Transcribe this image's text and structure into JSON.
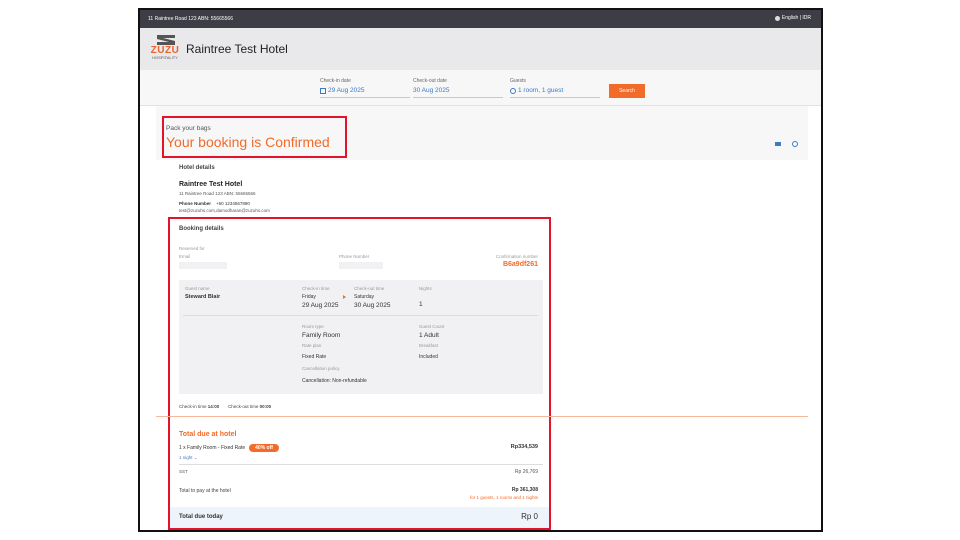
{
  "topbar": {
    "address": "11 Raintree Road 123 ABN: 55665566",
    "language": "English | IDR"
  },
  "logo": {
    "text": "ZUZU",
    "sub": "HOSPITALITY"
  },
  "hotel": {
    "name": "Raintree Test Hotel"
  },
  "search": {
    "checkin_label": "Check-in date",
    "checkin_value": "29 Aug 2025",
    "checkout_label": "Check-out date",
    "checkout_value": "30 Aug 2025",
    "guests_label": "Guests",
    "guests_value": "1 room, 1 guest",
    "button": "Search"
  },
  "confirmation": {
    "eyebrow": "Pack your bags",
    "headline": "Your booking is Confirmed"
  },
  "hotel_details": {
    "title": "Hotel details",
    "name": "Raintree Test Hotel",
    "address": "11 Raintree Road 123 ABN: 55665566",
    "phone_label": "Phone Number",
    "phone": "+60 1234567890",
    "email": "test@zuzuhs.com,damodharan@zuzuhs.com"
  },
  "booking": {
    "title": "Booking details",
    "reserved_for_label": "Reserved for",
    "email_label": "Email",
    "phone_label": "Phone Number",
    "confirmation_label": "Confirmation number",
    "confirmation_number": "B6a9df261",
    "guest_name_label": "Guest name",
    "guest_name": "Steward Blair",
    "checkin_time_label": "Check-in time",
    "checkin_day": "Friday",
    "checkin_date": "29 Aug 2025",
    "checkout_time_label": "Check-out time",
    "checkout_day": "Saturday",
    "checkout_date": "30 Aug 2025",
    "nights_label": "Nights",
    "nights": "1",
    "room_type_label": "Room type",
    "room_type": "Family Room",
    "guest_count_label": "Guest Count",
    "guest_count": "1 Adult",
    "rate_plan_label": "Rate plan",
    "rate_plan": "Fixed Rate",
    "breakfast_label": "Breakfast",
    "breakfast": "Included",
    "cancellation_label": "Cancellation policy",
    "cancellation": "Cancellation: Non-refundable",
    "checkin_time_text": "Check-in time",
    "checkin_time": "14:00",
    "checkout_time_text": "Check-out time",
    "checkout_time": "00:00"
  },
  "totals": {
    "title": "Total due at hotel",
    "line_item": "1 x Family Room - Fixed Rate",
    "discount_badge": "40% off",
    "line_price": "Rp334,539",
    "nights_link": "1 night",
    "tax_label": "SST",
    "tax_value": "Rp 26,769",
    "total_label": "Total to pay at the hotel",
    "total_value": "Rp 361,308",
    "total_sub": "for 1 guests, 1 rooms and 1 nights",
    "due_today_label": "Total due today",
    "due_today_value": "Rp 0"
  },
  "colors": {
    "accent": "#f26b29",
    "link": "#3b7ac9",
    "highlight": "#e2132b",
    "topbar": "#3c3d45"
  }
}
